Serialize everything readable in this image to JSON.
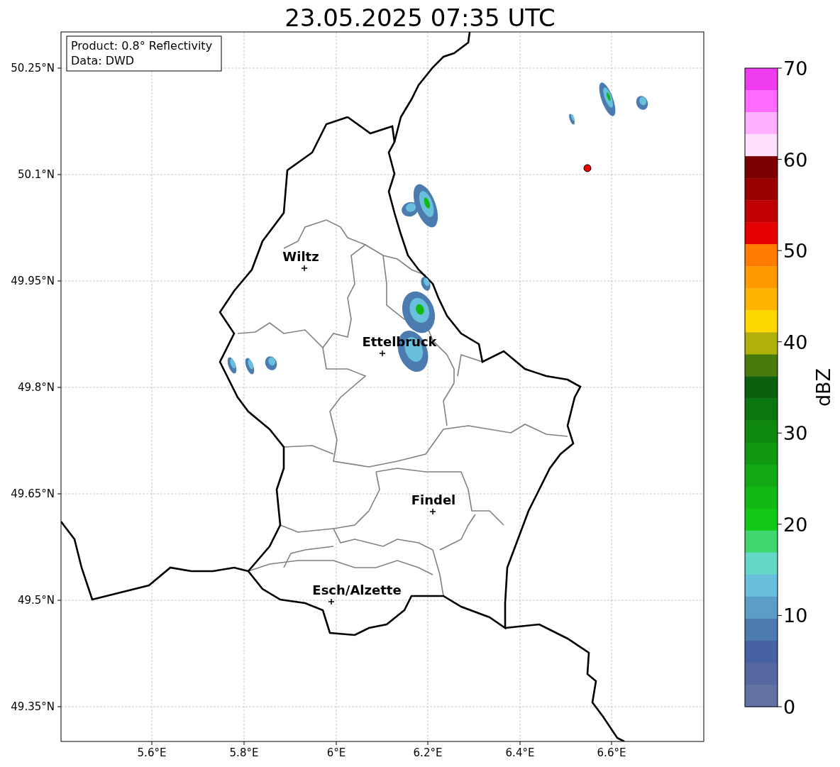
{
  "title": "23.05.2025 07:35 UTC",
  "info_box": [
    "Product: 0.8° Reflectivity",
    "Data: DWD"
  ],
  "lat_labels": [
    "50.25°N",
    "50.1°N",
    "49.95°N",
    "49.8°N",
    "49.65°N",
    "49.5°N",
    "49.35°N"
  ],
  "lon_labels": [
    "5.6°E",
    "5.8°E",
    "6°E",
    "6.2°E",
    "6.4°E",
    "6.6°E"
  ],
  "cities": [
    {
      "name": "Wiltz"
    },
    {
      "name": "Ettelbruck"
    },
    {
      "name": "Findel"
    },
    {
      "name": "Esch/Alzette"
    }
  ],
  "colorbar": {
    "label": "dBZ",
    "ticks": [
      "70",
      "60",
      "50",
      "40",
      "30",
      "20",
      "10",
      "0"
    ],
    "bins": [
      {
        "color": "#ee3cee"
      },
      {
        "color": "#ff6cff"
      },
      {
        "color": "#ffb0ff"
      },
      {
        "color": "#ffe0ff"
      },
      {
        "color": "#7a0000"
      },
      {
        "color": "#9a0000"
      },
      {
        "color": "#c00000"
      },
      {
        "color": "#e40000"
      },
      {
        "color": "#ff7c00"
      },
      {
        "color": "#ff9a00"
      },
      {
        "color": "#ffb400"
      },
      {
        "color": "#ffd800"
      },
      {
        "color": "#b0b00a"
      },
      {
        "color": "#487a0c"
      },
      {
        "color": "#0a600e"
      },
      {
        "color": "#0a7610"
      },
      {
        "color": "#0e880e"
      },
      {
        "color": "#109810"
      },
      {
        "color": "#12a814"
      },
      {
        "color": "#12b814"
      },
      {
        "color": "#14c818"
      },
      {
        "color": "#40d670"
      },
      {
        "color": "#66d8c8"
      },
      {
        "color": "#68c0dc"
      },
      {
        "color": "#5a9ec8"
      },
      {
        "color": "#4c7bb0"
      },
      {
        "color": "#4662a4"
      },
      {
        "color": "#5568a0"
      },
      {
        "color": "#6272a4"
      }
    ]
  }
}
